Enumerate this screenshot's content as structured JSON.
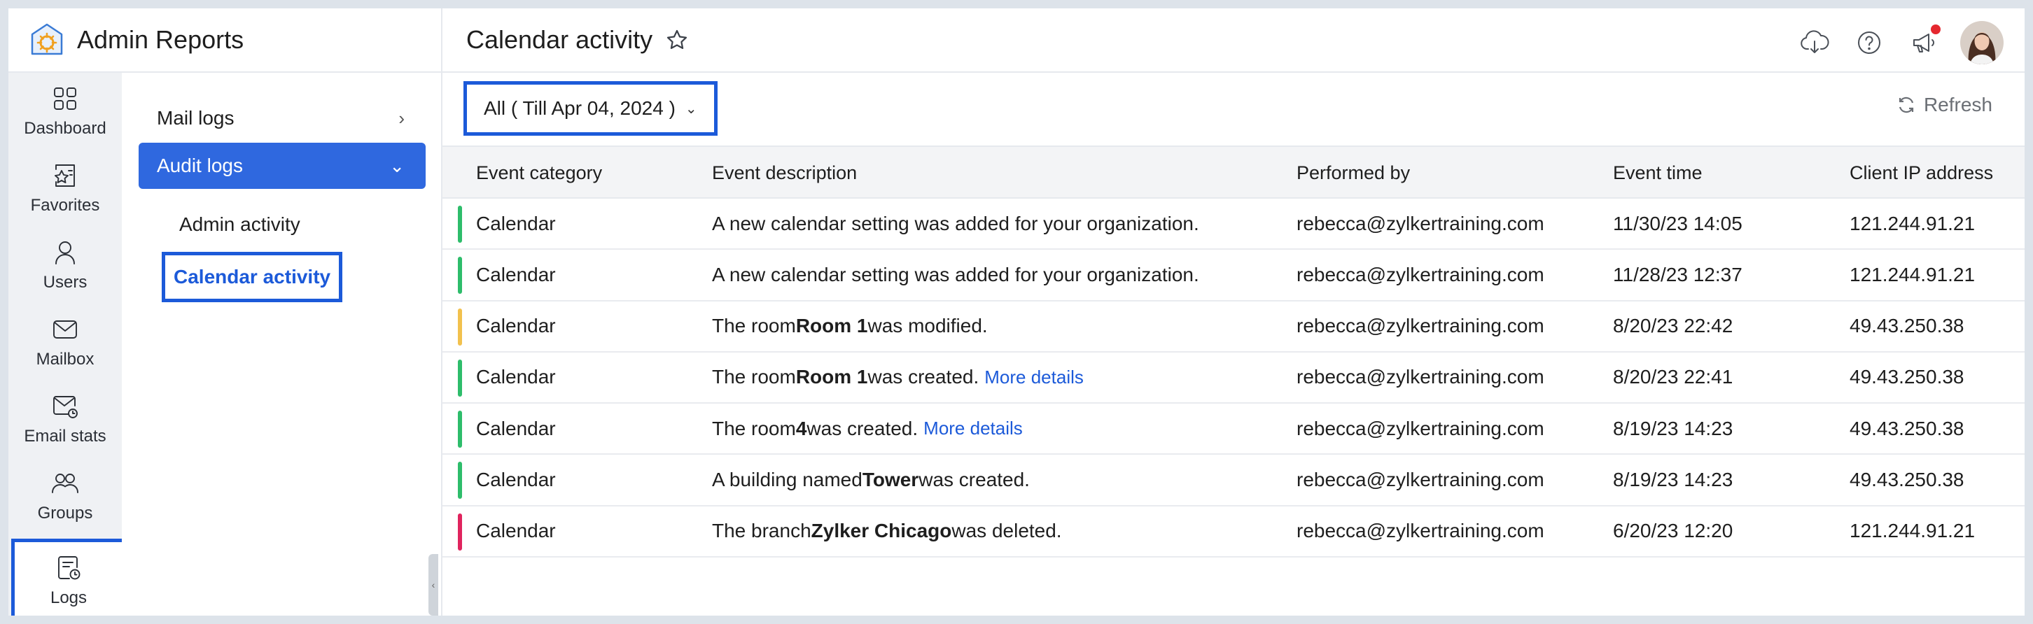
{
  "app": {
    "title": "Admin Reports"
  },
  "rail": [
    {
      "label": "Dashboard",
      "icon": "dashboard-icon"
    },
    {
      "label": "Favorites",
      "icon": "favorites-icon"
    },
    {
      "label": "Users",
      "icon": "user-icon"
    },
    {
      "label": "Mailbox",
      "icon": "mail-icon"
    },
    {
      "label": "Email stats",
      "icon": "email-stats-icon"
    },
    {
      "label": "Groups",
      "icon": "groups-icon"
    },
    {
      "label": "Logs",
      "icon": "logs-icon",
      "active": true
    }
  ],
  "subnav": {
    "mail_logs": "Mail logs",
    "audit_logs": "Audit logs",
    "admin_activity": "Admin activity",
    "calendar_activity": "Calendar activity"
  },
  "header": {
    "page_title": "Calendar activity",
    "icons": [
      "download-icon",
      "help-icon",
      "announcement-icon"
    ]
  },
  "toolbar": {
    "filter_value": "All ( Till Apr 04, 2024 )",
    "refresh_label": "Refresh"
  },
  "table": {
    "columns": [
      "Event category",
      "Event description",
      "Performed by",
      "Event time",
      "Client IP address"
    ],
    "rows": [
      {
        "severity_color": "#2ebd6b",
        "category": "Calendar",
        "desc_pre": "A new calendar setting was added for your organization.",
        "desc_bold": "",
        "desc_post": "",
        "more": "",
        "user": "rebecca@zylkertraining.com",
        "time": "11/30/23 14:05",
        "ip": "121.244.91.21"
      },
      {
        "severity_color": "#2ebd6b",
        "category": "Calendar",
        "desc_pre": "A new calendar setting was added for your organization.",
        "desc_bold": "",
        "desc_post": "",
        "more": "",
        "user": "rebecca@zylkertraining.com",
        "time": "11/28/23 12:37",
        "ip": "121.244.91.21"
      },
      {
        "severity_color": "#f2c14e",
        "category": "Calendar",
        "desc_pre": "The room ",
        "desc_bold": "Room 1",
        "desc_post": " was modified.",
        "more": "",
        "user": "rebecca@zylkertraining.com",
        "time": "8/20/23 22:42",
        "ip": "49.43.250.38"
      },
      {
        "severity_color": "#2ebd6b",
        "category": "Calendar",
        "desc_pre": "The room ",
        "desc_bold": "Room 1",
        "desc_post": " was created.",
        "more": "More details",
        "user": "rebecca@zylkertraining.com",
        "time": "8/20/23 22:41",
        "ip": "49.43.250.38"
      },
      {
        "severity_color": "#2ebd6b",
        "category": "Calendar",
        "desc_pre": "The room ",
        "desc_bold": "4",
        "desc_post": " was created.",
        "more": "More details",
        "user": "rebecca@zylkertraining.com",
        "time": "8/19/23 14:23",
        "ip": "49.43.250.38"
      },
      {
        "severity_color": "#2ebd6b",
        "category": "Calendar",
        "desc_pre": "A building named ",
        "desc_bold": "Tower",
        "desc_post": " was created.",
        "more": "",
        "user": "rebecca@zylkertraining.com",
        "time": "8/19/23 14:23",
        "ip": "49.43.250.38"
      },
      {
        "severity_color": "#e0245e",
        "category": "Calendar",
        "desc_pre": "The branch ",
        "desc_bold": "Zylker Chicago",
        "desc_post": " was deleted.",
        "more": "",
        "user": "rebecca@zylkertraining.com",
        "time": "6/20/23 12:20",
        "ip": "121.244.91.21"
      }
    ]
  }
}
